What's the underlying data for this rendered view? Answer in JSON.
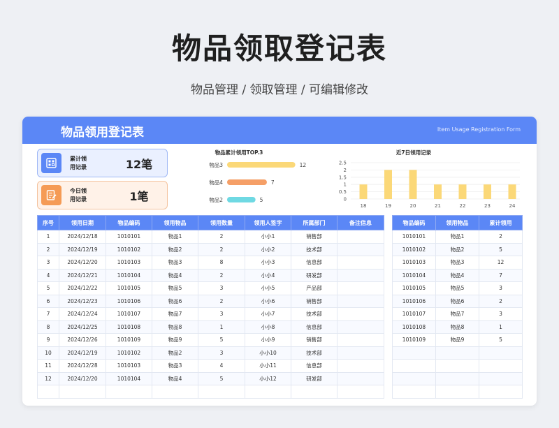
{
  "page": {
    "title": "物品领取登记表",
    "subtitle": "物品管理 / 领取管理 / 可编辑修改"
  },
  "card": {
    "title": "物品领用登记表",
    "subtitle_en": "Item Usage Registration Form"
  },
  "stats": [
    {
      "label": "累计领用记录",
      "label_line1": "累计领",
      "label_line2": "用记录",
      "value": "12笔",
      "icon": "building-icon",
      "color": "#5b87f6"
    },
    {
      "label": "今日领用记录",
      "label_line1": "今日领",
      "label_line2": "用记录",
      "value": "1笔",
      "icon": "document-edit-icon",
      "color": "#f59b55"
    }
  ],
  "chart_data": [
    {
      "type": "bar",
      "orientation": "horizontal",
      "title": "物品累计领用TOP.3",
      "categories": [
        "物品3",
        "物品4",
        "物品2"
      ],
      "values": [
        12,
        7,
        5
      ],
      "colors": [
        "#fbd878",
        "#f59f67",
        "#6fd9e3"
      ],
      "xlim": [
        0,
        12
      ]
    },
    {
      "type": "bar",
      "title": "近7日领用记录",
      "categories": [
        "18",
        "19",
        "20",
        "21",
        "22",
        "23",
        "24"
      ],
      "values": [
        1,
        2,
        2,
        1,
        1,
        1,
        1
      ],
      "yticks": [
        "0",
        "0.5",
        "1",
        "1.5",
        "2",
        "2.5"
      ],
      "ylim": [
        0,
        2.5
      ],
      "color": "#fbd878",
      "grid": true
    }
  ],
  "main_table": {
    "headers": [
      "序号",
      "领用日期",
      "物品编码",
      "领用物品",
      "领用数量",
      "领用人签字",
      "所属部门",
      "备注信息"
    ],
    "rows": [
      [
        "1",
        "2024/12/18",
        "1010101",
        "物品1",
        "2",
        "小小1",
        "销售部",
        ""
      ],
      [
        "2",
        "2024/12/19",
        "1010102",
        "物品2",
        "2",
        "小小2",
        "技术部",
        ""
      ],
      [
        "3",
        "2024/12/20",
        "1010103",
        "物品3",
        "8",
        "小小3",
        "信息部",
        ""
      ],
      [
        "4",
        "2024/12/21",
        "1010104",
        "物品4",
        "2",
        "小小4",
        "研发部",
        ""
      ],
      [
        "5",
        "2024/12/22",
        "1010105",
        "物品5",
        "3",
        "小小5",
        "产品部",
        ""
      ],
      [
        "6",
        "2024/12/23",
        "1010106",
        "物品6",
        "2",
        "小小6",
        "销售部",
        ""
      ],
      [
        "7",
        "2024/12/24",
        "1010107",
        "物品7",
        "3",
        "小小7",
        "技术部",
        ""
      ],
      [
        "8",
        "2024/12/25",
        "1010108",
        "物品8",
        "1",
        "小小8",
        "信息部",
        ""
      ],
      [
        "9",
        "2024/12/26",
        "1010109",
        "物品9",
        "5",
        "小小9",
        "销售部",
        ""
      ],
      [
        "10",
        "2024/12/19",
        "1010102",
        "物品2",
        "3",
        "小小10",
        "技术部",
        ""
      ],
      [
        "11",
        "2024/12/28",
        "1010103",
        "物品3",
        "4",
        "小小11",
        "信息部",
        ""
      ],
      [
        "12",
        "2024/12/20",
        "1010104",
        "物品4",
        "5",
        "小小12",
        "研发部",
        ""
      ],
      [
        "",
        "",
        "",
        "",
        "",
        "",
        "",
        ""
      ]
    ]
  },
  "summary_table": {
    "headers": [
      "物品编码",
      "领用物品",
      "累计领用"
    ],
    "rows": [
      [
        "1010101",
        "物品1",
        "2"
      ],
      [
        "1010102",
        "物品2",
        "5"
      ],
      [
        "1010103",
        "物品3",
        "12"
      ],
      [
        "1010104",
        "物品4",
        "7"
      ],
      [
        "1010105",
        "物品5",
        "3"
      ],
      [
        "1010106",
        "物品6",
        "2"
      ],
      [
        "1010107",
        "物品7",
        "3"
      ],
      [
        "1010108",
        "物品8",
        "1"
      ],
      [
        "1010109",
        "物品9",
        "5"
      ],
      [
        "",
        "",
        ""
      ],
      [
        "",
        "",
        ""
      ],
      [
        "",
        "",
        ""
      ],
      [
        "",
        "",
        ""
      ]
    ]
  }
}
